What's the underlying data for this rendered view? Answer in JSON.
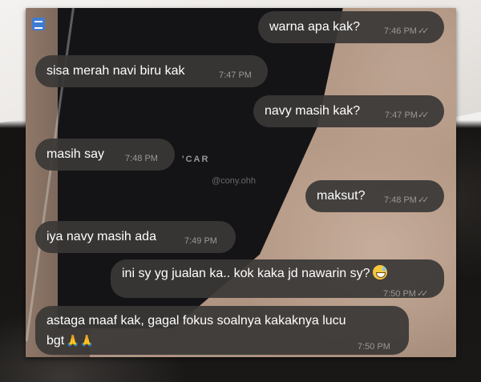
{
  "messages": [
    {
      "direction": "out",
      "text": "warna apa kak?",
      "time": "7:46 PM"
    },
    {
      "direction": "in",
      "text": "sisa merah navi biru kak",
      "time": "7:47 PM"
    },
    {
      "direction": "out",
      "text": "navy masih kak?",
      "time": "7:47 PM"
    },
    {
      "direction": "in",
      "text": "masih say",
      "time": "7:48 PM"
    },
    {
      "direction": "out",
      "text": "maksut?",
      "time": "7:48 PM"
    },
    {
      "direction": "in",
      "text": "iya navy masih ada",
      "time": "7:49 PM"
    },
    {
      "direction": "out",
      "text": "ini sy yg jualan ka.. kok kaka jd nawarin sy?",
      "time": "7:50 PM",
      "emoji": "sweat-smile"
    },
    {
      "direction": "in",
      "text_line1": "astaga maaf kak, gagal fokus soalnya kakaknya lucu",
      "text_line2": "bgt",
      "time": "7:50 PM",
      "emoji": "folded-hands-x2"
    }
  ],
  "photo": {
    "watermark": "@cony.ohh",
    "shirt_print": "'CAR"
  },
  "icons": {
    "read_receipt": "double-check-icon",
    "corner": "chat-app-icon",
    "emoji_sweat_smile": "sweat-smile-emoji-icon",
    "emoji_pray": "folded-hands-emoji-icon"
  },
  "colors": {
    "bubble": "#3a3837",
    "text": "#ffffff",
    "meta": "#9a9897"
  }
}
